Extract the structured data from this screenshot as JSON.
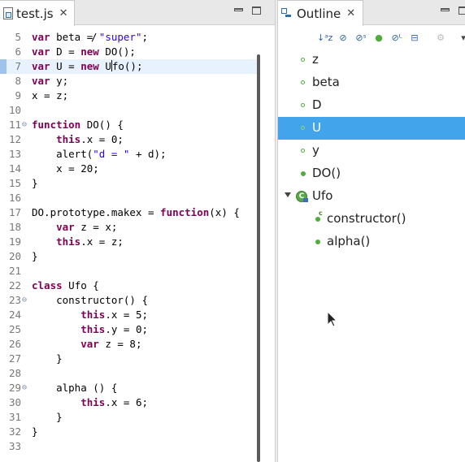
{
  "editor": {
    "tab_title": "test.js",
    "top_partial_fragment": "/",
    "lines": [
      {
        "num": "5",
        "fold": "",
        "tokens": [
          [
            "kw",
            "var"
          ],
          [
            "",
            "beta = "
          ],
          [
            "str",
            "\"super\""
          ],
          [
            "",
            ";"
          ]
        ]
      },
      {
        "num": "6",
        "fold": "",
        "tokens": [
          [
            "kw",
            "var"
          ],
          [
            "",
            "D = "
          ],
          [
            "kw",
            "new"
          ],
          [
            "",
            " DO();"
          ]
        ]
      },
      {
        "num": "7",
        "fold": "",
        "current": true,
        "tokens": [
          [
            "kw",
            "var"
          ],
          [
            "",
            "U = "
          ],
          [
            "kw",
            "new"
          ],
          [
            "",
            " U"
          ],
          [
            "caret",
            ""
          ],
          [
            "",
            "fo();"
          ]
        ]
      },
      {
        "num": "8",
        "fold": "",
        "tokens": [
          [
            "kw",
            "var"
          ],
          [
            "",
            "y;"
          ]
        ]
      },
      {
        "num": "9",
        "fold": "",
        "tokens": [
          [
            "",
            "x = z;"
          ]
        ]
      },
      {
        "num": "10",
        "fold": "",
        "tokens": []
      },
      {
        "num": "11",
        "fold": "⊖",
        "tokens": [
          [
            "kw",
            "function"
          ],
          [
            "",
            " DO() {"
          ]
        ]
      },
      {
        "num": "12",
        "fold": "",
        "tokens": [
          [
            "",
            "    "
          ],
          [
            "kw",
            "this"
          ],
          [
            "",
            ".x = 0;"
          ]
        ]
      },
      {
        "num": "13",
        "fold": "",
        "tokens": [
          [
            "",
            "    alert("
          ],
          [
            "str",
            "\"d = \""
          ],
          [
            "",
            " + d);"
          ]
        ]
      },
      {
        "num": "14",
        "fold": "",
        "tokens": [
          [
            "",
            "    x = 20;"
          ]
        ]
      },
      {
        "num": "15",
        "fold": "",
        "tokens": [
          [
            "",
            "}"
          ]
        ]
      },
      {
        "num": "16",
        "fold": "",
        "tokens": []
      },
      {
        "num": "17",
        "fold": "",
        "tokens": [
          [
            "",
            "DO.prototype.makex = "
          ],
          [
            "kw",
            "function"
          ],
          [
            "",
            "(x) {"
          ]
        ]
      },
      {
        "num": "18",
        "fold": "",
        "tokens": [
          [
            "",
            "    "
          ],
          [
            "kw",
            "var"
          ],
          [
            "",
            " z = x;"
          ]
        ]
      },
      {
        "num": "19",
        "fold": "",
        "tokens": [
          [
            "",
            "    "
          ],
          [
            "kw",
            "this"
          ],
          [
            "",
            ".x = z;"
          ]
        ]
      },
      {
        "num": "20",
        "fold": "",
        "tokens": [
          [
            "",
            "}"
          ]
        ]
      },
      {
        "num": "21",
        "fold": "",
        "tokens": []
      },
      {
        "num": "22",
        "fold": "",
        "tokens": [
          [
            "kw",
            "class"
          ],
          [
            "",
            " Ufo {"
          ]
        ]
      },
      {
        "num": "23",
        "fold": "⊖",
        "tokens": [
          [
            "",
            "    constructor() {"
          ]
        ]
      },
      {
        "num": "24",
        "fold": "",
        "tokens": [
          [
            "",
            "        "
          ],
          [
            "kw",
            "this"
          ],
          [
            "",
            ".x = 5;"
          ]
        ]
      },
      {
        "num": "25",
        "fold": "",
        "tokens": [
          [
            "",
            "        "
          ],
          [
            "kw",
            "this"
          ],
          [
            "",
            ".y = 0;"
          ]
        ]
      },
      {
        "num": "26",
        "fold": "",
        "tokens": [
          [
            "",
            "        "
          ],
          [
            "kw",
            "var"
          ],
          [
            "",
            " z = 8;"
          ]
        ]
      },
      {
        "num": "27",
        "fold": "",
        "tokens": [
          [
            "",
            "    }"
          ]
        ]
      },
      {
        "num": "28",
        "fold": "",
        "tokens": []
      },
      {
        "num": "29",
        "fold": "⊖",
        "tokens": [
          [
            "",
            "    alpha () {"
          ]
        ]
      },
      {
        "num": "30",
        "fold": "",
        "tokens": [
          [
            "",
            "        "
          ],
          [
            "kw",
            "this"
          ],
          [
            "",
            ".x = 6;"
          ]
        ]
      },
      {
        "num": "31",
        "fold": "",
        "tokens": [
          [
            "",
            "    }"
          ]
        ]
      },
      {
        "num": "32",
        "fold": "",
        "tokens": [
          [
            "",
            "}"
          ]
        ]
      },
      {
        "num": "33",
        "fold": "",
        "tokens": []
      }
    ]
  },
  "outline": {
    "tab_title": "Outline",
    "toolbar": [
      {
        "name": "sort-alpha-icon",
        "glyph": "↓ᵃz"
      },
      {
        "name": "hide-fields-icon",
        "glyph": "⊘"
      },
      {
        "name": "hide-static-icon",
        "glyph": "⊘ˢ"
      },
      {
        "name": "hide-nonpublic-icon",
        "glyph": "●"
      },
      {
        "name": "hide-local-types-icon",
        "glyph": "⊘ᴸ"
      },
      {
        "name": "collapse-all-icon",
        "glyph": "⊟"
      },
      {
        "name": "link-editor-icon",
        "glyph": "⚙"
      }
    ],
    "items": [
      {
        "label": "z",
        "kind": "var",
        "indent": 0
      },
      {
        "label": "beta",
        "kind": "var",
        "indent": 0
      },
      {
        "label": "D",
        "kind": "var",
        "indent": 0
      },
      {
        "label": "U",
        "kind": "var",
        "indent": 0,
        "selected": true
      },
      {
        "label": "y",
        "kind": "var",
        "indent": 0
      },
      {
        "label": "DO()",
        "kind": "function",
        "indent": 0
      },
      {
        "label": "Ufo",
        "kind": "class",
        "indent": 0,
        "expanded": true
      },
      {
        "label": "constructor()",
        "kind": "constructor",
        "indent": 1
      },
      {
        "label": "alpha()",
        "kind": "method",
        "indent": 1
      }
    ]
  },
  "colors": {
    "selection": "#42a5eb",
    "keyword": "#7f0055",
    "string": "#2a00ff",
    "current_line": "#e8f2fe",
    "method_dot": "#4fae3a"
  }
}
